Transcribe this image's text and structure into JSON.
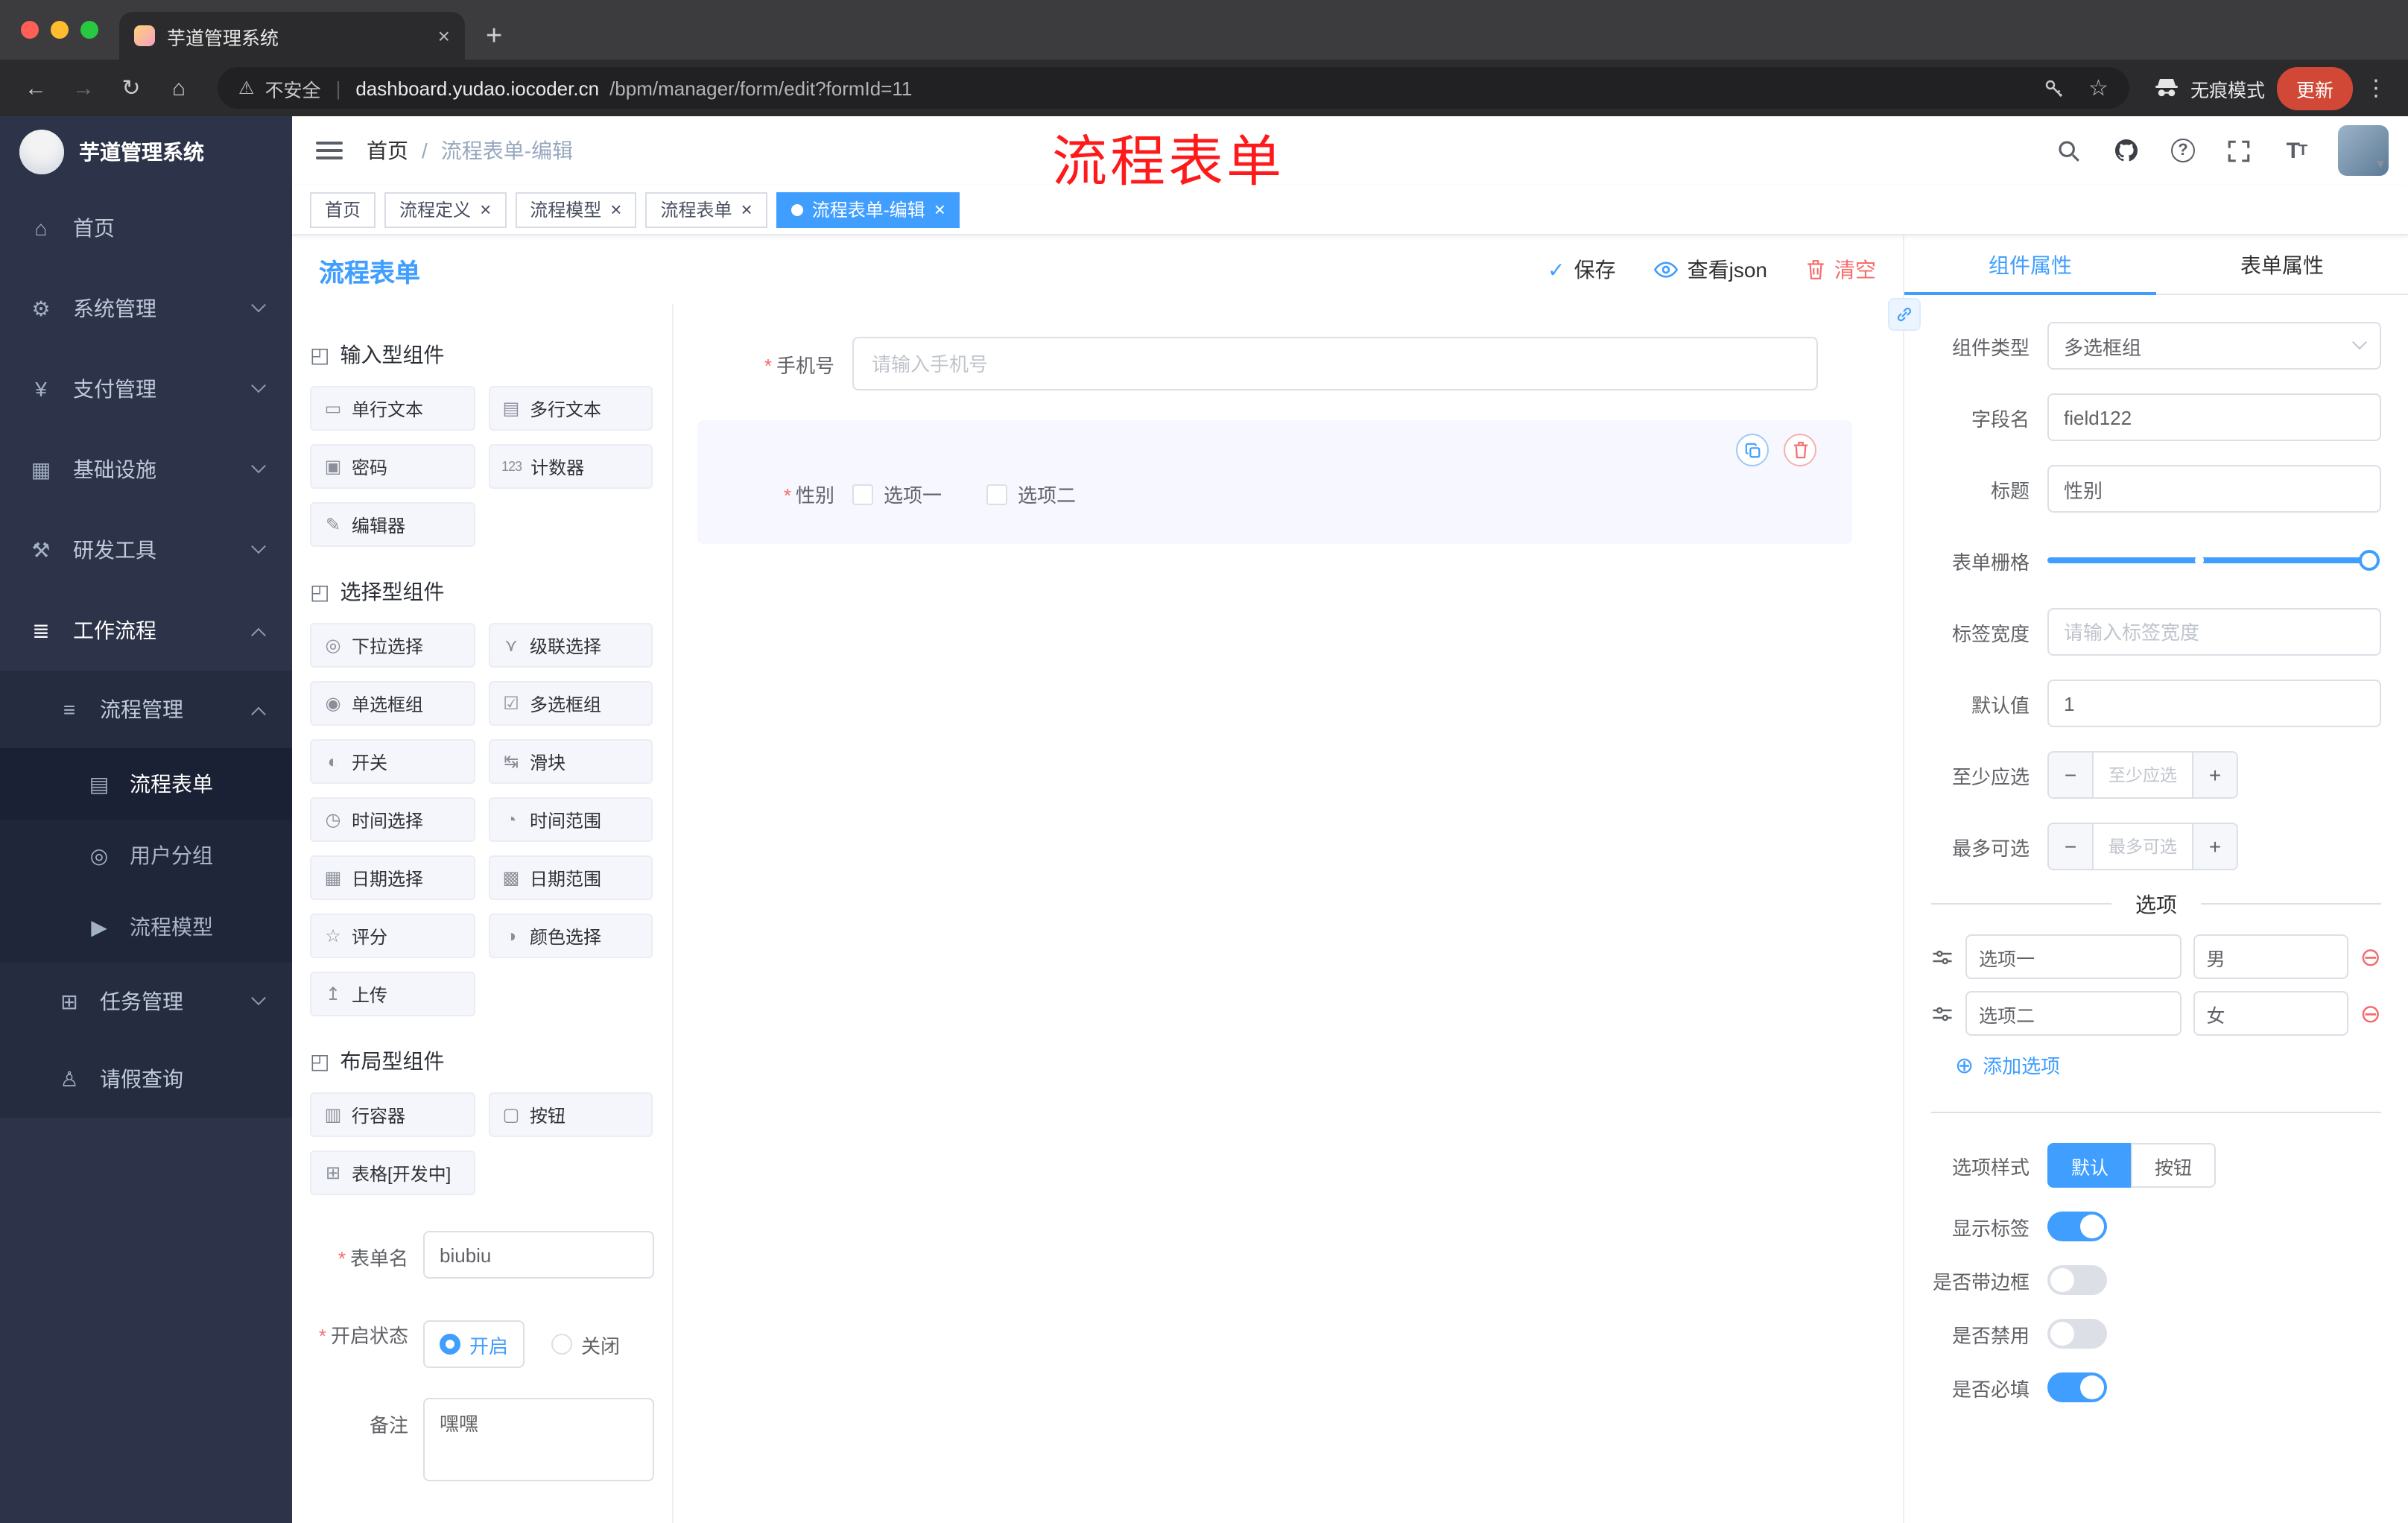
{
  "ui": {
    "close": "×",
    "plus": "+",
    "minus": "−",
    "check": "✓",
    "add_circle": "⊕",
    "remove_circle": "⊖",
    "chevron_down": "▾"
  },
  "annotation": {
    "text": "流程表单"
  },
  "browser": {
    "tab": {
      "title": "芋道管理系统"
    },
    "new_tab_icon": "+",
    "nav": {
      "back": "←",
      "forward": "→",
      "reload": "↻",
      "home": "⌂"
    },
    "security_icon": "⚠",
    "security_label": "不安全",
    "url_host": "dashboard.yudao.iocoder.cn",
    "url_path": "/bpm/manager/form/edit?formId=11",
    "star_icon": "☆",
    "incognito_label": "无痕模式",
    "update_label": "更新",
    "menu_icon": "⋮"
  },
  "sidebar": {
    "logo_title": "芋道管理系统",
    "menu": [
      {
        "label": "首页",
        "glyph": "⌂",
        "icon": "home-icon"
      },
      {
        "label": "系统管理",
        "glyph": "⚙",
        "icon": "gear-icon"
      },
      {
        "label": "支付管理",
        "glyph": "¥",
        "icon": "payment-icon"
      },
      {
        "label": "基础设施",
        "glyph": "▦",
        "icon": "infrastructure-icon"
      },
      {
        "label": "研发工具",
        "glyph": "⚒",
        "icon": "devtools-icon"
      },
      {
        "label": "工作流程",
        "glyph": "≣",
        "icon": "workflow-icon"
      }
    ],
    "process_mgmt": {
      "label": "流程管理",
      "glyph": "≡",
      "children": [
        {
          "label": "流程表单",
          "glyph": "▤",
          "active": true
        },
        {
          "label": "用户分组",
          "glyph": "◎"
        },
        {
          "label": "流程模型",
          "glyph": "▶"
        }
      ]
    },
    "task_mgmt": {
      "label": "任务管理",
      "glyph": "⊞"
    },
    "leave_query": {
      "label": "请假查询",
      "glyph": "♙"
    }
  },
  "header": {
    "breadcrumb_home": "首页",
    "breadcrumb_sep": "/",
    "breadcrumb_current": "流程表单-编辑"
  },
  "tags": [
    {
      "label": "首页",
      "closable": false,
      "active": false
    },
    {
      "label": "流程定义",
      "closable": true,
      "active": false
    },
    {
      "label": "流程模型",
      "closable": true,
      "active": false
    },
    {
      "label": "流程表单",
      "closable": true,
      "active": false
    },
    {
      "label": "流程表单-编辑",
      "closable": true,
      "active": true
    }
  ],
  "designer": {
    "title": "流程表单",
    "save_icon": "✓",
    "save_label": "保存",
    "view_json_label": "查看json",
    "clear_label": "清空"
  },
  "palette": {
    "sections": [
      {
        "title": "输入型组件",
        "glyph": "◰",
        "items": [
          {
            "label": "单行文本",
            "glyph": "▭",
            "icon": "single-line-text-icon"
          },
          {
            "label": "多行文本",
            "glyph": "▤",
            "icon": "multiline-text-icon"
          },
          {
            "label": "密码",
            "glyph": "▣",
            "icon": "password-icon"
          },
          {
            "label": "计数器",
            "glyph": "123",
            "icon": "counter-icon"
          },
          {
            "label": "编辑器",
            "glyph": "✎",
            "icon": "editor-icon"
          }
        ]
      },
      {
        "title": "选择型组件",
        "glyph": "◰",
        "items": [
          {
            "label": "下拉选择",
            "glyph": "◎",
            "icon": "dropdown-icon"
          },
          {
            "label": "级联选择",
            "glyph": "⋎",
            "icon": "cascader-icon"
          },
          {
            "label": "单选框组",
            "glyph": "◉",
            "icon": "radio-group-icon"
          },
          {
            "label": "多选框组",
            "glyph": "☑",
            "icon": "checkbox-group-icon"
          },
          {
            "label": "开关",
            "glyph": "◐",
            "icon": "switch-icon"
          },
          {
            "label": "滑块",
            "glyph": "↹",
            "icon": "slider-icon"
          },
          {
            "label": "时间选择",
            "glyph": "◷",
            "icon": "time-picker-icon"
          },
          {
            "label": "时间范围",
            "glyph": "◔",
            "icon": "time-range-icon"
          },
          {
            "label": "日期选择",
            "glyph": "▦",
            "icon": "date-picker-icon"
          },
          {
            "label": "日期范围",
            "glyph": "▩",
            "icon": "date-range-icon"
          },
          {
            "label": "评分",
            "glyph": "☆",
            "icon": "rate-icon"
          },
          {
            "label": "颜色选择",
            "glyph": "◑",
            "icon": "color-picker-icon"
          },
          {
            "label": "上传",
            "glyph": "↥",
            "icon": "upload-icon"
          }
        ]
      },
      {
        "title": "布局型组件",
        "glyph": "◰",
        "items": [
          {
            "label": "行容器",
            "glyph": "▥",
            "icon": "row-container-icon"
          },
          {
            "label": "按钮",
            "glyph": "▢",
            "icon": "button-icon"
          },
          {
            "label": "表格[开发中]",
            "glyph": "⊞",
            "icon": "table-icon"
          }
        ]
      }
    ],
    "meta": {
      "name_label": "表单名",
      "name_value": "biubiu",
      "status_label": "开启状态",
      "status_on": "开启",
      "status_off": "关闭",
      "remark_label": "备注",
      "remark_value": "嘿嘿"
    }
  },
  "canvas": {
    "phone": {
      "label": "手机号",
      "placeholder": "请输入手机号"
    },
    "gender": {
      "label": "性别",
      "options": [
        "选项一",
        "选项二"
      ]
    }
  },
  "props": {
    "tab_component": "组件属性",
    "tab_form": "表单属性",
    "component_type_label": "组件类型",
    "component_type_value": "多选框组",
    "field_name_label": "字段名",
    "field_name_value": "field122",
    "title_label": "标题",
    "title_value": "性别",
    "grid_label": "表单栅格",
    "label_width_label": "标签宽度",
    "label_width_placeholder": "请输入标签宽度",
    "default_label": "默认值",
    "default_value": "1",
    "min_label": "至少应选",
    "min_placeholder": "至少应选",
    "max_label": "最多可选",
    "max_placeholder": "最多可选",
    "options_title": "选项",
    "options": [
      {
        "name": "选项一",
        "value": "男"
      },
      {
        "name": "选项二",
        "value": "女"
      }
    ],
    "add_option_label": "添加选项",
    "style_label": "选项样式",
    "style_default": "默认",
    "style_button": "按钮",
    "toggle_show_label": "显示标签",
    "toggle_border_label": "是否带边框",
    "toggle_disabled_label": "是否禁用",
    "toggle_required_label": "是否必填"
  },
  "colors": {
    "accent": "#409eff",
    "danger": "#f56c6c",
    "annotation_red": "#fe1a1a",
    "sidebar_bg": "#2d3348"
  }
}
